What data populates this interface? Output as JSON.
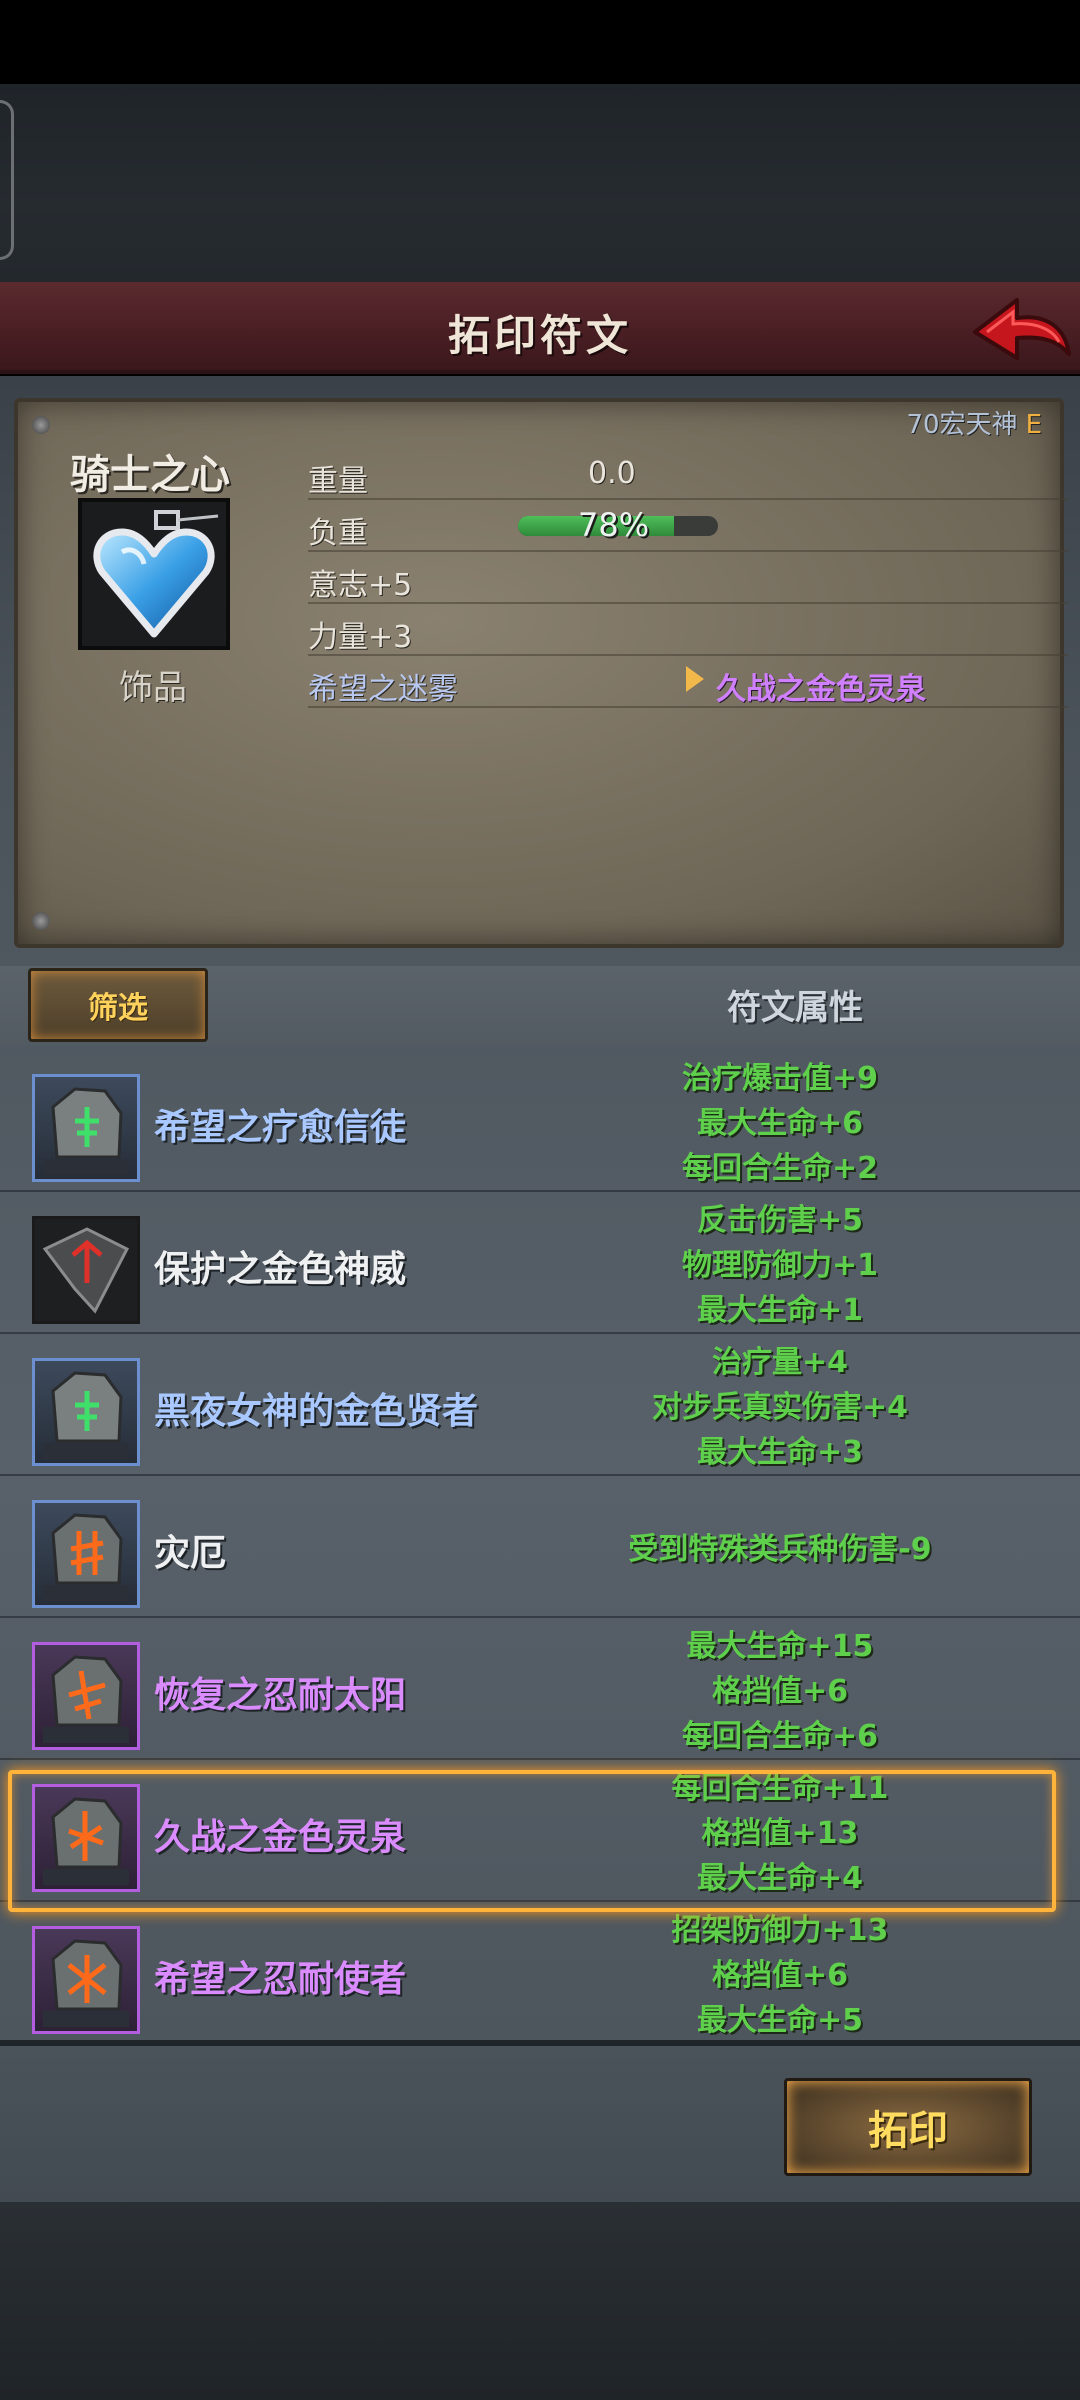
{
  "header": {
    "title": "拓印符文"
  },
  "item": {
    "rank": "70宏天神",
    "grade": "E",
    "name": "骑士之心",
    "type": "饰品",
    "stats": [
      {
        "label": "重量",
        "value": "0.0"
      },
      {
        "label": "负重",
        "value": "78%",
        "load_fraction": 0.78
      },
      {
        "label": "意志+5"
      },
      {
        "label": "力量+3"
      },
      {
        "label": "希望之迷雾",
        "target": "久战之金色灵泉"
      }
    ]
  },
  "filter": {
    "button_label": "筛选",
    "column_header": "符文属性"
  },
  "runes": [
    {
      "name": "希望之疗愈信徒",
      "attrs": [
        "治疗爆击值+9",
        "最大生命+6",
        "每回合生命+2"
      ]
    },
    {
      "name": "保护之金色神威",
      "attrs": [
        "反击伤害+5",
        "物理防御力+1",
        "最大生命+1"
      ]
    },
    {
      "name": "黑夜女神的金色贤者",
      "attrs": [
        "治疗量+4",
        "对步兵真实伤害+4",
        "最大生命+3"
      ]
    },
    {
      "name": "灾厄",
      "attrs": [
        "受到特殊类兵种伤害-9"
      ]
    },
    {
      "name": "恢复之忍耐太阳",
      "attrs": [
        "最大生命+15",
        "格挡值+6",
        "每回合生命+6"
      ]
    },
    {
      "name": "久战之金色灵泉",
      "attrs": [
        "每回合生命+11",
        "格挡值+13",
        "最大生命+4"
      ],
      "selected": true
    },
    {
      "name": "希望之忍耐使者",
      "attrs": [
        "招架防御力+13",
        "格挡值+6",
        "最大生命+5"
      ]
    }
  ],
  "action": {
    "imprint_label": "拓印"
  },
  "colors": {
    "selected_border": "#ffb33a",
    "attr_green": "#5ed04c",
    "rare_purple": "#da8cff",
    "common_blue": "#a8c8ff"
  }
}
